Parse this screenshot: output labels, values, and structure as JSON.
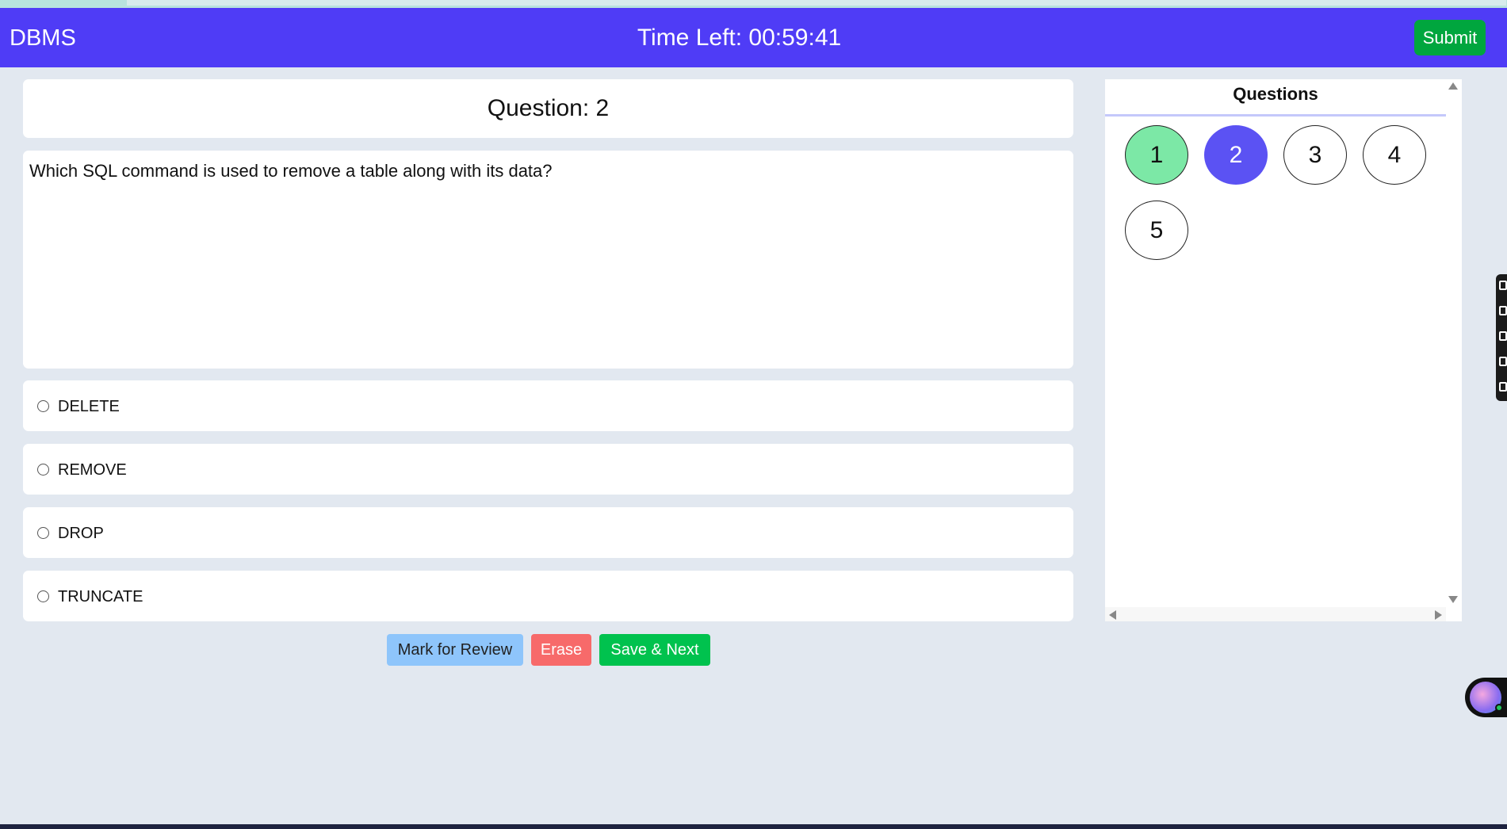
{
  "header": {
    "title": "DBMS",
    "timer": "Time Left: 00:59:41",
    "submit_label": "Submit"
  },
  "question": {
    "title": "Question: 2",
    "text": "Which SQL command is used to remove a table along with its data?",
    "options": [
      {
        "label": "DELETE",
        "selected": false
      },
      {
        "label": "REMOVE",
        "selected": false
      },
      {
        "label": "DROP",
        "selected": false
      },
      {
        "label": "TRUNCATE",
        "selected": false
      }
    ]
  },
  "actions": {
    "mark_review_label": "Mark for Review",
    "erase_label": "Erase",
    "save_next_label": "Save & Next"
  },
  "palette": {
    "title": "Questions",
    "numbers": [
      {
        "label": "1",
        "status": "answered"
      },
      {
        "label": "2",
        "status": "current"
      },
      {
        "label": "3",
        "status": "unvisited"
      },
      {
        "label": "4",
        "status": "unvisited"
      },
      {
        "label": "5",
        "status": "unvisited"
      }
    ]
  },
  "colors": {
    "header": "#4f3cf6",
    "submit": "#00a63e",
    "answered": "#7ce8a6",
    "current": "#5b52f3",
    "mark_review": "#8ec5fb",
    "erase": "#f76a6a",
    "save_next": "#00c24e"
  }
}
